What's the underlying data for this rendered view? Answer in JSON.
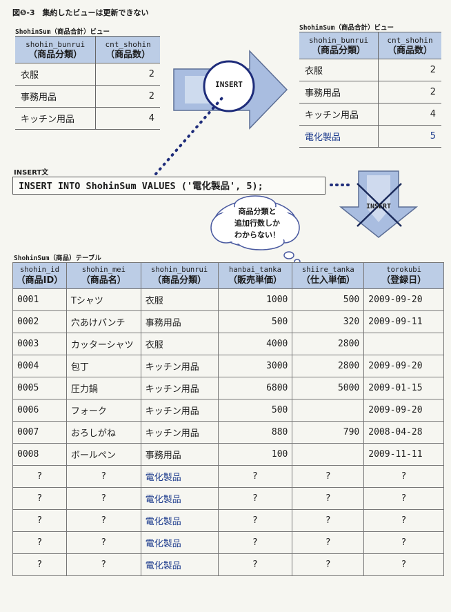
{
  "figure_title": "図❺-3　集約したビューは更新できない",
  "view_before": {
    "caption": "ShohinSum（商品合計）ビュー",
    "headers": [
      {
        "en": "shohin_bunrui",
        "ja": "（商品分類）"
      },
      {
        "en": "cnt_shohin",
        "ja": "（商品数）"
      }
    ],
    "rows": [
      {
        "bunrui": "衣服",
        "cnt": "2"
      },
      {
        "bunrui": "事務用品",
        "cnt": "2"
      },
      {
        "bunrui": "キッチン用品",
        "cnt": "4"
      }
    ]
  },
  "view_after": {
    "caption": "ShohinSum（商品合計）ビュー",
    "headers": [
      {
        "en": "shohin_bunrui",
        "ja": "（商品分類）"
      },
      {
        "en": "cnt_shohin",
        "ja": "（商品数）"
      }
    ],
    "rows": [
      {
        "bunrui": "衣服",
        "cnt": "2"
      },
      {
        "bunrui": "事務用品",
        "cnt": "2"
      },
      {
        "bunrui": "キッチン用品",
        "cnt": "4"
      },
      {
        "bunrui": "電化製品",
        "cnt": "5"
      }
    ]
  },
  "arrow_label": "INSERT",
  "down_arrow_label": "INSERT",
  "sql_caption": "INSERT文",
  "sql": "INSERT INTO ShohinSum VALUES ('電化製品', 5);",
  "thought": [
    "商品分類と",
    "追加行数しか",
    "わからない！"
  ],
  "table": {
    "caption": "ShohinSum（商品）テーブル",
    "headers": [
      {
        "en": "shohin_id",
        "ja": "（商品ID）"
      },
      {
        "en": "shohin_mei",
        "ja": "（商品名）"
      },
      {
        "en": "shohin_bunrui",
        "ja": "（商品分類）"
      },
      {
        "en": "hanbai_tanka",
        "ja": "（販売単価）"
      },
      {
        "en": "shiire_tanka",
        "ja": "（仕入単価）"
      },
      {
        "en": "torokubi",
        "ja": "（登録日）"
      }
    ],
    "rows": [
      [
        "0001",
        "Tシャツ",
        "衣服",
        "1000",
        "500",
        "2009-09-20"
      ],
      [
        "0002",
        "穴あけパンチ",
        "事務用品",
        "500",
        "320",
        "2009-09-11"
      ],
      [
        "0003",
        "カッターシャツ",
        "衣服",
        "4000",
        "2800",
        ""
      ],
      [
        "0004",
        "包丁",
        "キッチン用品",
        "3000",
        "2800",
        "2009-09-20"
      ],
      [
        "0005",
        "圧力鍋",
        "キッチン用品",
        "6800",
        "5000",
        "2009-01-15"
      ],
      [
        "0006",
        "フォーク",
        "キッチン用品",
        "500",
        "",
        "2009-09-20"
      ],
      [
        "0007",
        "おろしがね",
        "キッチン用品",
        "880",
        "790",
        "2008-04-28"
      ],
      [
        "0008",
        "ボールペン",
        "事務用品",
        "100",
        "",
        "2009-11-11"
      ],
      [
        "?",
        "?",
        "電化製品",
        "?",
        "?",
        "?"
      ],
      [
        "?",
        "?",
        "電化製品",
        "?",
        "?",
        "?"
      ],
      [
        "?",
        "?",
        "電化製品",
        "?",
        "?",
        "?"
      ],
      [
        "?",
        "?",
        "電化製品",
        "?",
        "?",
        "?"
      ],
      [
        "?",
        "?",
        "電化製品",
        "?",
        "?",
        "?"
      ]
    ]
  },
  "colors": {
    "header_fill": "#bccde6",
    "arrow_fill": "#a9bde0",
    "new_row_text": "#1b3a8c",
    "circle_stroke": "#1e2c7a"
  }
}
